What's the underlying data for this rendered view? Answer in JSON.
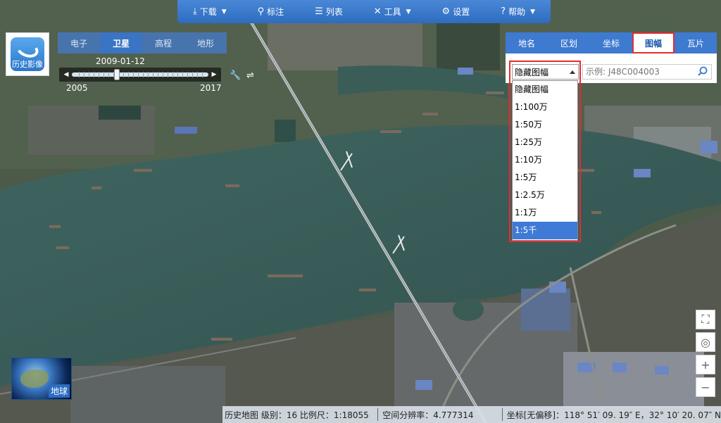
{
  "toolbar": {
    "items": [
      {
        "label": "下载",
        "icon": "download-icon",
        "has_menu": true
      },
      {
        "label": "标注",
        "icon": "pin-icon",
        "has_menu": false
      },
      {
        "label": "列表",
        "icon": "list-icon",
        "has_menu": false
      },
      {
        "label": "工具",
        "icon": "tools-icon",
        "has_menu": true
      },
      {
        "label": "设置",
        "icon": "gear-icon",
        "has_menu": false
      },
      {
        "label": "帮助",
        "icon": "help-icon",
        "has_menu": true
      }
    ]
  },
  "logo": {
    "label": "历史影像"
  },
  "map_types": {
    "tabs": [
      "电子",
      "卫星",
      "高程",
      "地形"
    ],
    "active": "卫星"
  },
  "timeline": {
    "current_date": "2009-01-12",
    "start_year": "2005",
    "end_year": "2017",
    "position_fraction": 0.33
  },
  "panel": {
    "tabs": [
      "地名",
      "区划",
      "坐标",
      "图幅",
      "瓦片"
    ],
    "active_tab": "图幅",
    "select_value": "隐藏图幅",
    "search_placeholder": "示例: J48C004003"
  },
  "dropdown": {
    "options": [
      "隐藏图幅",
      "1:100万",
      "1:50万",
      "1:25万",
      "1:10万",
      "1:5万",
      "1:2.5万",
      "1:1万",
      "1:5千"
    ],
    "highlighted": "1:5千"
  },
  "map_controls": [
    "fullscreen-icon",
    "locate-icon",
    "zoom-in-icon",
    "zoom-out-icon"
  ],
  "globe": {
    "label": "地球"
  },
  "status": {
    "map_info": "历史地图  级别：16  比例尺：1:18055",
    "resolution": "空间分辨率：4.777314",
    "coords": "坐标[无偏移]：118° 51′ 09. 19″ E，32° 10′ 20. 07″ N"
  },
  "colors": {
    "accent": "#2d6cc0",
    "highlight_border": "#e32d2d",
    "river": "#3f5f5c"
  }
}
